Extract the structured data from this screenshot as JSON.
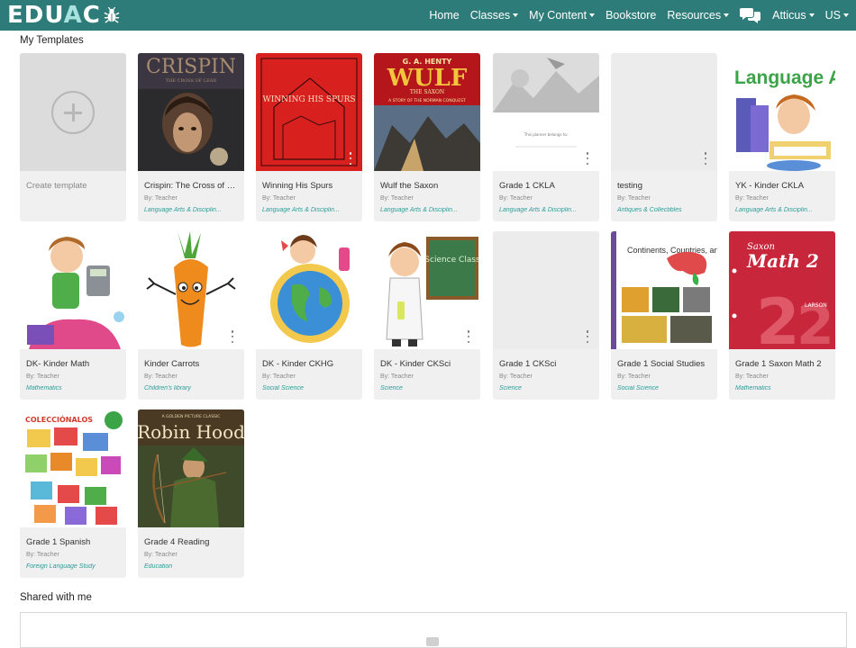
{
  "logo": {
    "part1": "EDU",
    "part2": "A",
    "part3": "C"
  },
  "nav": {
    "home": "Home",
    "classes": "Classes",
    "my_content": "My Content",
    "bookstore": "Bookstore",
    "resources": "Resources",
    "user": "Atticus",
    "locale": "US"
  },
  "sections": {
    "my_templates": "My Templates",
    "shared_with_me": "Shared with me"
  },
  "create_template": "Create template",
  "cards": [
    {
      "title": "Crispin: The Cross of Le...",
      "author": "By: Teacher",
      "category": "Language Arts & Disciplin..."
    },
    {
      "title": "Winning His Spurs",
      "author": "By: Teacher",
      "category": "Language Arts & Disciplin..."
    },
    {
      "title": "Wulf the Saxon",
      "author": "By: Teacher",
      "category": "Language Arts & Disciplin..."
    },
    {
      "title": "Grade 1 CKLA",
      "author": "By: Teacher",
      "category": "Language Arts & Disciplin..."
    },
    {
      "title": "testing",
      "author": "By: Teacher",
      "category": "Antiques & Collectibles"
    },
    {
      "title": "YK - Kinder CKLA",
      "author": "By: Teacher",
      "category": "Language Arts & Disciplin..."
    },
    {
      "title": "DK- Kinder Math",
      "author": "By: Teacher",
      "category": "Mathematics"
    },
    {
      "title": "Kinder Carrots",
      "author": "By: Teacher",
      "category": "Children's library"
    },
    {
      "title": "DK - Kinder CKHG",
      "author": "By: Teacher",
      "category": "Social Science"
    },
    {
      "title": "DK - Kinder CKSci",
      "author": "By: Teacher",
      "category": "Science"
    },
    {
      "title": "Grade 1 CKSci",
      "author": "By: Teacher",
      "category": "Science"
    },
    {
      "title": "Grade 1 Social Studies",
      "author": "By: Teacher",
      "category": "Social Science"
    },
    {
      "title": "Grade 1 Saxon Math 2",
      "author": "By: Teacher",
      "category": "Mathematics"
    },
    {
      "title": "Grade 1 Spanish",
      "author": "By: Teacher",
      "category": "Foreign Language Study"
    },
    {
      "title": "Grade 4 Reading",
      "author": "By: Teacher",
      "category": "Education"
    }
  ],
  "cover_text": {
    "crispin": "CRISPIN",
    "crispin_sub": "THE CROSS OF LEAD",
    "winning": "WINNING HIS SPURS",
    "henty": "G. A. HENTY",
    "wulf": "WULF",
    "wulf_sub": "THE SAXON",
    "wulf_story": "A STORY OF THE NORMAN CONQUEST",
    "ckla_note": "This planner belongs to:",
    "lang_arts": "Language Arts",
    "science_class": "Science Class",
    "continents": "Continents, Countries, and Maps",
    "saxon": "Saxon",
    "math2": "Math 2",
    "larson": "LARSON",
    "coleccionalos": "COLECCIÓNALOS",
    "golden": "A GOLDEN PICTURE CLASSIC",
    "robin": "Robin Hood"
  },
  "colors": {
    "navbar": "#2e7c7a",
    "category": "#2a9d9a",
    "card_bg": "#f0f0f0"
  },
  "icons": [
    "plus-icon",
    "bug-icon",
    "chat-bubbles-icon",
    "more-vertical-icon",
    "empty-folder-icon"
  ]
}
